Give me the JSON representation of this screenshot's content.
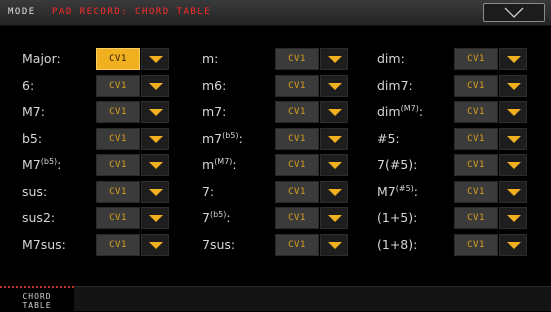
{
  "header": {
    "mode_label": "MODE",
    "mode_title": "PAD RECORD: CHORD TABLE",
    "menu_icon": "chevron-down-icon"
  },
  "colors": {
    "accent": "#f0b020",
    "title_red": "#ff2a2a",
    "selector_text": "#d9a21a"
  },
  "chords": [
    [
      {
        "name": "Major:",
        "sup": "",
        "value": "CV1",
        "active": true
      },
      {
        "name": "m:",
        "sup": "",
        "value": "CV1"
      },
      {
        "name": "dim:",
        "sup": "",
        "value": "CV1"
      }
    ],
    [
      {
        "name": "6:",
        "sup": "",
        "value": "CV1"
      },
      {
        "name": "m6:",
        "sup": "",
        "value": "CV1"
      },
      {
        "name": "dim7:",
        "sup": "",
        "value": "CV1"
      }
    ],
    [
      {
        "name": "M7:",
        "sup": "",
        "value": "CV1"
      },
      {
        "name": "m7:",
        "sup": "",
        "value": "CV1"
      },
      {
        "name": "dim",
        "sup": "(M7)",
        "tail": ":",
        "value": "CV1"
      }
    ],
    [
      {
        "name": "b5:",
        "sup": "",
        "value": "CV1"
      },
      {
        "name": "m7",
        "sup": "(b5)",
        "tail": ":",
        "value": "CV1"
      },
      {
        "name": "#5:",
        "sup": "",
        "value": "CV1"
      }
    ],
    [
      {
        "name": "M7",
        "sup": "(b5)",
        "tail": ":",
        "value": "CV1"
      },
      {
        "name": "m",
        "sup": "(M7)",
        "tail": ":",
        "value": "CV1"
      },
      {
        "name": "7(#5):",
        "sup": "",
        "value": "CV1"
      }
    ],
    [
      {
        "name": "sus:",
        "sup": "",
        "value": "CV1"
      },
      {
        "name": "7:",
        "sup": "",
        "value": "CV1"
      },
      {
        "name": "M7",
        "sup": "(#5)",
        "tail": ":",
        "value": "CV1"
      }
    ],
    [
      {
        "name": "sus2:",
        "sup": "",
        "value": "CV1"
      },
      {
        "name": "7",
        "sup": "(b5)",
        "tail": ":",
        "value": "CV1"
      },
      {
        "name": "(1+5):",
        "sup": "",
        "value": "CV1"
      }
    ],
    [
      {
        "name": "M7sus:",
        "sup": "",
        "value": "CV1"
      },
      {
        "name": "7sus:",
        "sup": "",
        "value": "CV1"
      },
      {
        "name": "(1+8):",
        "sup": "",
        "value": "CV1"
      }
    ]
  ],
  "tabs": [
    {
      "label_line1": "CHORD",
      "label_line2": "TABLE",
      "selected": true
    }
  ]
}
